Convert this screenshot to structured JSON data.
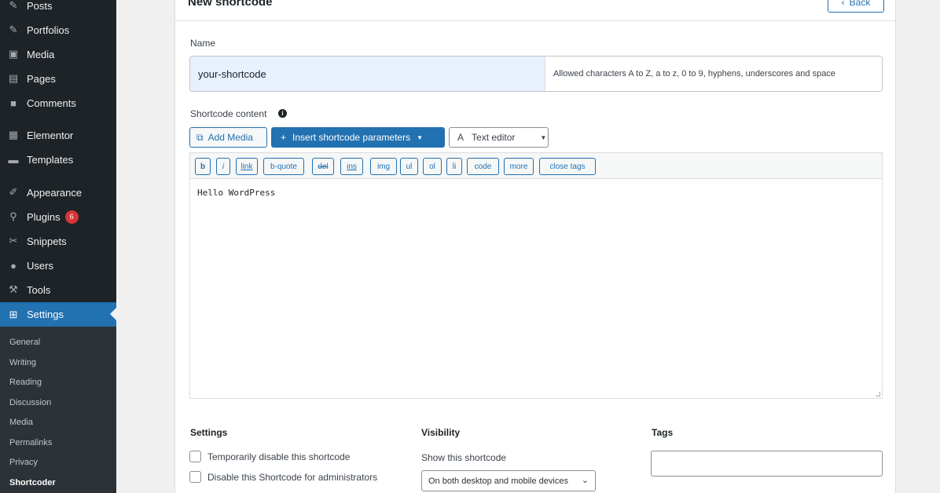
{
  "sidebar": {
    "menu": [
      {
        "label": "Posts",
        "icon": "pin-icon"
      },
      {
        "label": "Portfolios",
        "icon": "pin-icon"
      },
      {
        "label": "Media",
        "icon": "media-icon"
      },
      {
        "label": "Pages",
        "icon": "pages-icon"
      },
      {
        "label": "Comments",
        "icon": "comments-icon"
      },
      {
        "label": "Elementor",
        "icon": "elementor-icon"
      },
      {
        "label": "Templates",
        "icon": "folder-icon"
      },
      {
        "label": "Appearance",
        "icon": "brush-icon"
      },
      {
        "label": "Plugins",
        "icon": "plugin-icon",
        "badge": "6"
      },
      {
        "label": "Snippets",
        "icon": "snippets-icon"
      },
      {
        "label": "Users",
        "icon": "user-icon"
      },
      {
        "label": "Tools",
        "icon": "wrench-icon"
      },
      {
        "label": "Settings",
        "icon": "settings-icon"
      }
    ],
    "submenu": [
      "General",
      "Writing",
      "Reading",
      "Discussion",
      "Media",
      "Permalinks",
      "Privacy",
      "Shortcoder"
    ]
  },
  "header": {
    "title": "New shortcode",
    "back_label": "Back"
  },
  "form": {
    "name_label": "Name",
    "name_value": "your-shortcode",
    "name_hint": "Allowed characters A to Z, a to z, 0 to 9, hyphens, underscores and space",
    "content_label": "Shortcode content",
    "add_media_label": "Add Media",
    "insert_params_label": "Insert shortcode parameters",
    "text_editor_label": "Text editor",
    "quicktags": [
      "b",
      "i",
      "link",
      "b-quote",
      "del",
      "ins",
      "img",
      "ul",
      "ol",
      "li",
      "code",
      "more",
      "close tags"
    ],
    "editor_content": "Hello WordPress"
  },
  "settings": {
    "title": "Settings",
    "option_disable": "Temporarily disable this shortcode",
    "option_disable_admins": "Disable this Shortcode for administrators"
  },
  "visibility": {
    "title": "Visibility",
    "show_label": "Show this shortcode",
    "selected": "On both desktop and mobile devices"
  },
  "tags": {
    "title": "Tags"
  },
  "colors": {
    "accent": "#2271b1",
    "sidebar_bg": "#1d2327",
    "submenu_bg": "#2c3338",
    "badge": "#d63638"
  }
}
